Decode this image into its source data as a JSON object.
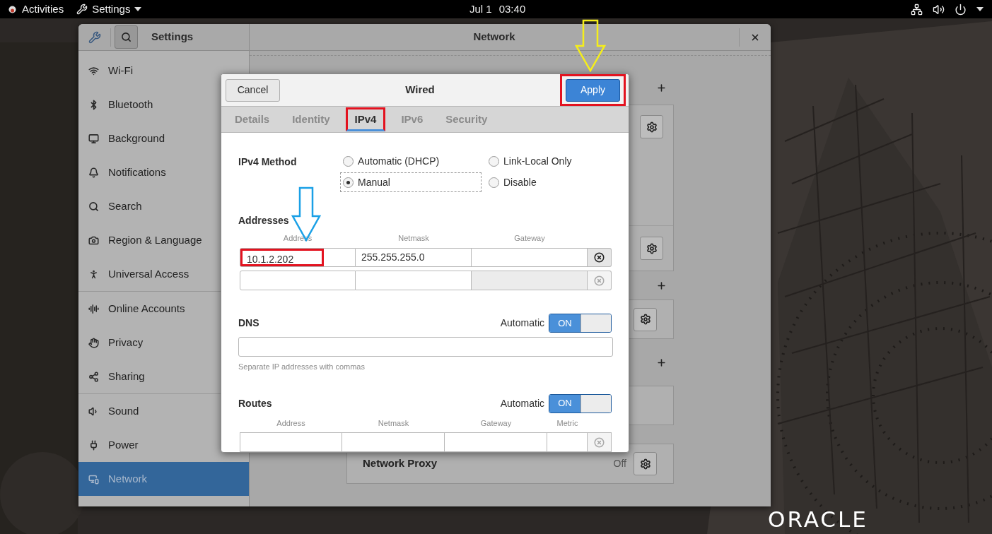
{
  "top_bar": {
    "activities": "Activities",
    "app_menu": "Settings",
    "date": "Jul 1",
    "time": "03:40"
  },
  "settings_window": {
    "sidebar_title": "Settings",
    "search_toggle": {
      "selected": true
    },
    "title": "Network",
    "sidebar": {
      "sections": [
        {
          "items": [
            {
              "label": "Wi-Fi",
              "selected": false
            },
            {
              "label": "Bluetooth",
              "selected": false
            },
            {
              "label": "Background",
              "selected": false
            },
            {
              "label": "Notifications",
              "selected": false
            },
            {
              "label": "Search",
              "selected": false
            },
            {
              "label": "Region & Language",
              "selected": false
            },
            {
              "label": "Universal Access",
              "selected": false
            }
          ]
        },
        {
          "items": [
            {
              "label": "Online Accounts",
              "selected": false
            },
            {
              "label": "Privacy",
              "selected": false
            },
            {
              "label": "Sharing",
              "selected": false
            }
          ]
        },
        {
          "items": [
            {
              "label": "Sound",
              "selected": false
            },
            {
              "label": "Power",
              "selected": false
            },
            {
              "label": "Network",
              "selected": true
            }
          ]
        }
      ]
    },
    "panel": {
      "proxy": {
        "label": "Network Proxy",
        "status": "Off"
      }
    }
  },
  "dialog": {
    "title": "Wired",
    "cancel": "Cancel",
    "apply": {
      "label": "Apply",
      "highlighted": true
    },
    "tabs": [
      {
        "label": "Details",
        "selected": false,
        "highlighted": false
      },
      {
        "label": "Identity",
        "selected": false,
        "highlighted": false
      },
      {
        "label": "IPv4",
        "selected": true,
        "highlighted": true
      },
      {
        "label": "IPv6",
        "selected": false,
        "highlighted": false
      },
      {
        "label": "Security",
        "selected": false,
        "highlighted": false
      }
    ],
    "method": {
      "label": "IPv4 Method",
      "options": [
        {
          "label": "Automatic (DHCP)",
          "selected": false,
          "focused": false
        },
        {
          "label": "Link-Local Only",
          "selected": false,
          "focused": false
        },
        {
          "label": "Manual",
          "selected": true,
          "focused": true
        },
        {
          "label": "Disable",
          "selected": false,
          "focused": false
        }
      ]
    },
    "addresses": {
      "title": "Addresses",
      "columns": [
        "Address",
        "Netmask",
        "Gateway"
      ],
      "rows": [
        {
          "address": "10.1.2.202",
          "netmask": "255.255.255.0",
          "highlighted": true,
          "gateway_disabled": false,
          "delete_enabled": true
        },
        {
          "highlighted": false,
          "gateway_disabled": true,
          "delete_enabled": false
        }
      ]
    },
    "dns": {
      "title": "DNS",
      "automatic_label": "Automatic",
      "switch": {
        "on": true,
        "label": "ON"
      },
      "hint": "Separate IP addresses with commas"
    },
    "routes": {
      "title": "Routes",
      "automatic_label": "Automatic",
      "switch": {
        "on": true,
        "label": "ON"
      },
      "columns": [
        "Address",
        "Netmask",
        "Gateway",
        "Metric"
      ]
    }
  },
  "logo": "ORACLE"
}
